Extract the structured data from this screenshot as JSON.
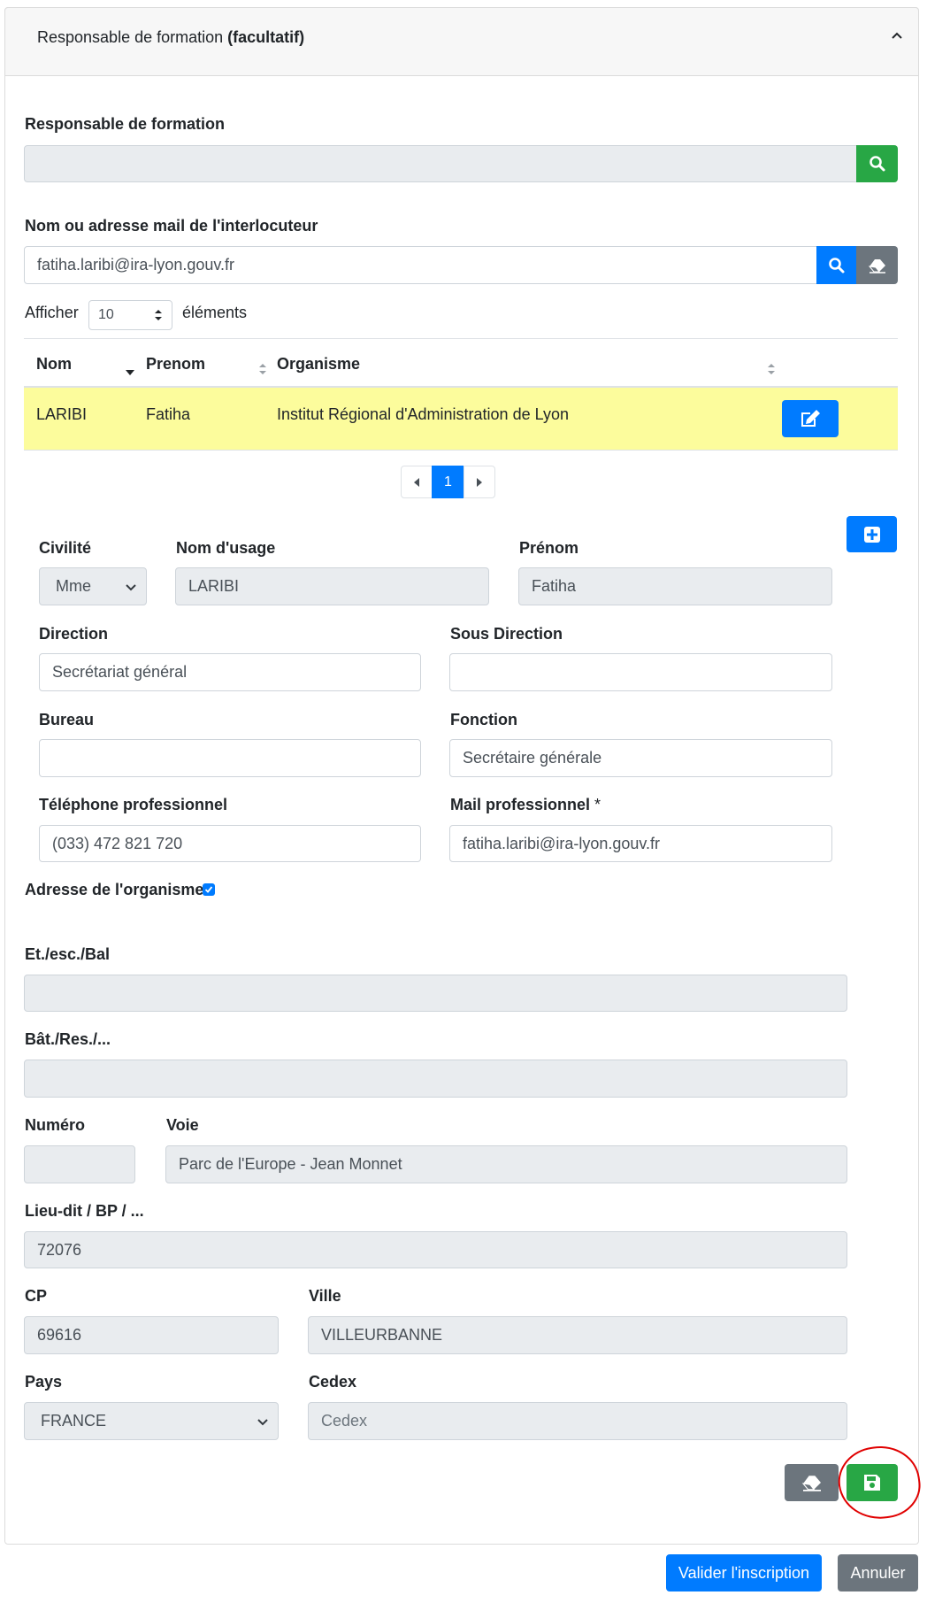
{
  "header": {
    "title_main": "Responsable de formation",
    "title_opt": "(facultatif)"
  },
  "responsable": {
    "label": "Responsable de formation",
    "value": ""
  },
  "interlocuteur": {
    "label": "Nom ou adresse mail de l'interlocuteur",
    "value": "fatiha.laribi@ira-lyon.gouv.fr"
  },
  "pagesize": {
    "prefix": "Afficher",
    "value": "10",
    "suffix": "éléments"
  },
  "table": {
    "headers": [
      "Nom",
      "Prenom",
      "Organisme"
    ],
    "rows": [
      {
        "nom": "LARIBI",
        "prenom": "Fatiha",
        "organisme": "Institut Régional d'Administration de Lyon"
      }
    ]
  },
  "pagination": {
    "current": "1"
  },
  "form": {
    "civilite": {
      "label": "Civilité",
      "value": "Mme"
    },
    "nom_usage": {
      "label": "Nom d'usage",
      "value": "LARIBI"
    },
    "prenom": {
      "label": "Prénom",
      "value": "Fatiha"
    },
    "direction": {
      "label": "Direction",
      "value": "Secrétariat général"
    },
    "sous_direction": {
      "label": "Sous Direction",
      "value": ""
    },
    "bureau": {
      "label": "Bureau",
      "value": ""
    },
    "fonction": {
      "label": "Fonction",
      "value": "Secrétaire générale"
    },
    "telephone": {
      "label": "Téléphone professionnel",
      "value": "(033) 472 821 720"
    },
    "mail": {
      "label": "Mail professionnel",
      "required": "*",
      "value": "fatiha.laribi@ira-lyon.gouv.fr"
    }
  },
  "adresse": {
    "label": "Adresse de l'organisme",
    "etage": {
      "label": "Et./esc./Bal",
      "value": ""
    },
    "batiment": {
      "label": "Bât./Res./...",
      "value": ""
    },
    "numero": {
      "label": "Numéro",
      "value": ""
    },
    "voie": {
      "label": "Voie",
      "value": "Parc de l'Europe - Jean Monnet"
    },
    "lieu_dit": {
      "label": "Lieu-dit / BP / ...",
      "value": "72076"
    },
    "cp": {
      "label": "CP",
      "value": "69616"
    },
    "ville": {
      "label": "Ville",
      "value": "VILLEURBANNE"
    },
    "pays": {
      "label": "Pays",
      "value": "FRANCE"
    },
    "cedex": {
      "label": "Cedex",
      "placeholder": "Cedex"
    }
  },
  "footer": {
    "valider": "Valider l'inscription",
    "annuler": "Annuler"
  },
  "colors": {
    "green": "#28a745",
    "blue": "#007bff",
    "gray": "#6c757d",
    "highlight": "#fcfc9c"
  }
}
